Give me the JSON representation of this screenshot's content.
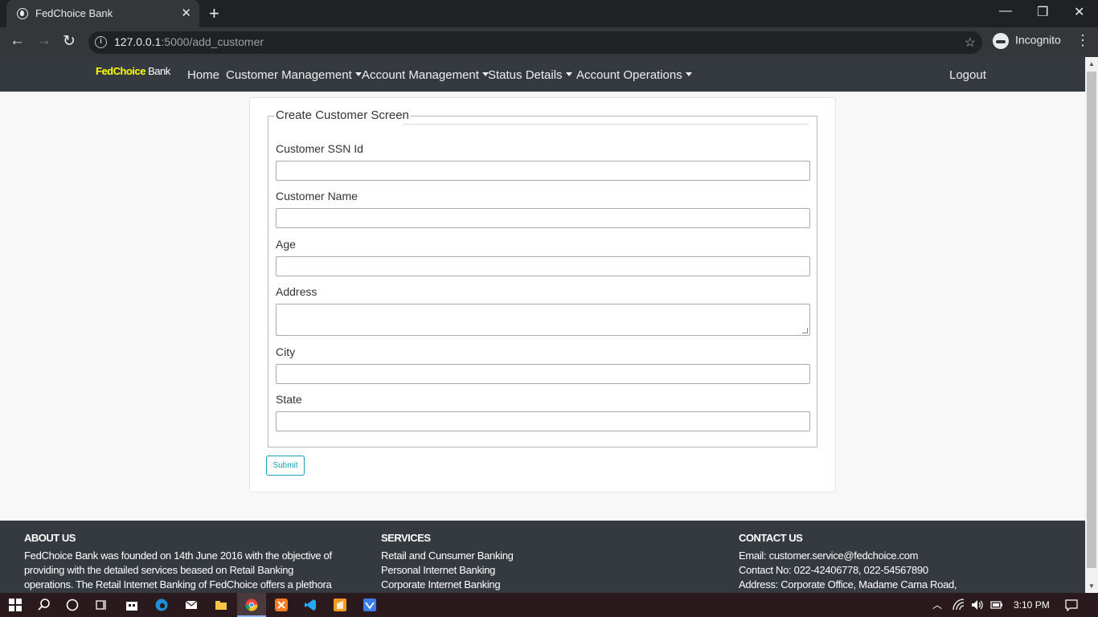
{
  "browser": {
    "tab_title": "FedChoice Bank",
    "tab_close": "✕",
    "new_tab": "+",
    "url_host": "127.0.0.1",
    "url_rest": ":5000/add_customer",
    "incognito_label": "Incognito",
    "back": "←",
    "forward": "→",
    "reload": "↻",
    "star": "☆",
    "menu": "⋮",
    "minimize": "—",
    "restore": "❐",
    "close": "✕"
  },
  "navbar": {
    "brand_part1": "FedChoice",
    "brand_part2": " Bank",
    "home": "Home",
    "customer_management": "Customer Management",
    "account_management": "Account Management",
    "status_details": "Status Details",
    "account_operations": "Account Operations",
    "logout": "Logout"
  },
  "form": {
    "legend": "Create Customer Screen",
    "fields": [
      {
        "label": "Customer SSN Id",
        "value": ""
      },
      {
        "label": "Customer Name",
        "value": ""
      },
      {
        "label": "Age",
        "value": ""
      },
      {
        "label": "Address",
        "value": ""
      },
      {
        "label": "City",
        "value": ""
      },
      {
        "label": "State",
        "value": ""
      }
    ],
    "submit_label": "Submit"
  },
  "footer": {
    "about": {
      "title": "ABOUT US",
      "lines": [
        "FedChoice Bank was founded on 14th June 2016 with the objective of",
        "providing with the detailed services beased on Retail Banking",
        "operations. The Retail Internet Banking of FedChoice offers a plethora"
      ]
    },
    "services": {
      "title": "SERVICES",
      "lines": [
        "Retail and Cunsumer Banking",
        "Personal Internet Banking",
        "Corporate Internet Banking"
      ]
    },
    "contact": {
      "title": "CONTACT US",
      "lines": [
        "Email: customer.service@fedchoice.com",
        "Contact No: 022-42406778, 022-54567890",
        "Address: Corporate Office, Madame Cama Road,"
      ]
    }
  },
  "taskbar": {
    "time": "3:10 PM",
    "colors": {
      "edge": "#1f8fd8",
      "folder": "#f4c542",
      "chrome": "#e8453c",
      "xampp": "#fb7a24",
      "vscode": "#23a9f2",
      "sublime": "#f59a23",
      "app": "#3c7ee8"
    }
  }
}
